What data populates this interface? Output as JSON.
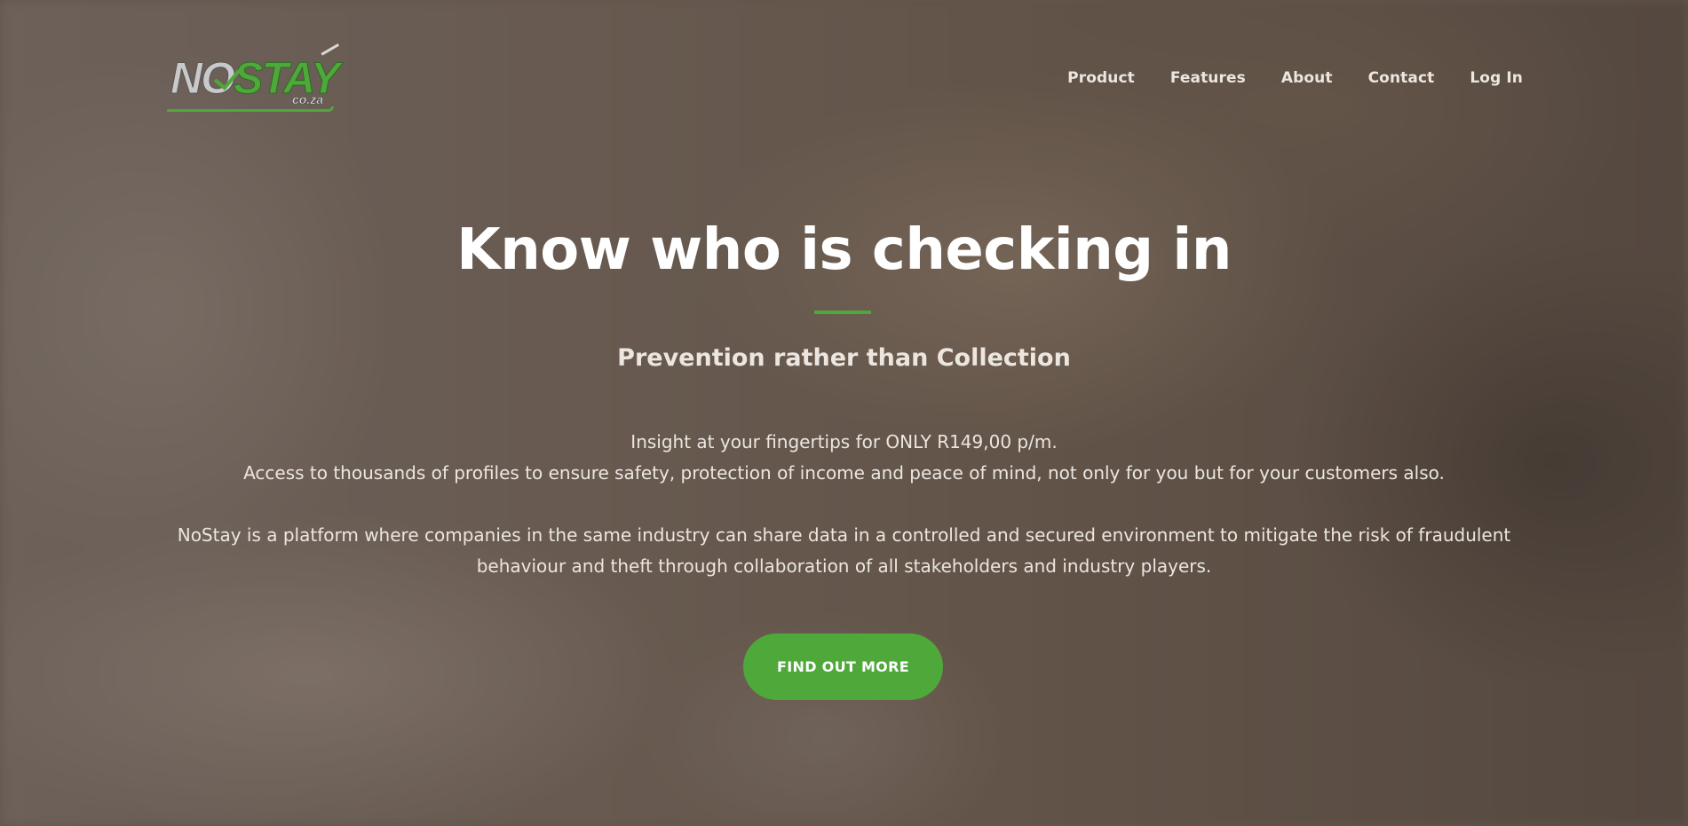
{
  "brand": {
    "logo_main_no": "NO",
    "logo_main_stay": "STAY",
    "logo_sub": "co.za",
    "accent_color": "#4ea83a"
  },
  "nav": {
    "items": [
      {
        "label": "Product"
      },
      {
        "label": "Features"
      },
      {
        "label": "About"
      },
      {
        "label": "Contact"
      },
      {
        "label": "Log In"
      }
    ]
  },
  "hero": {
    "headline": "Know who is checking in",
    "subheadline": "Prevention rather than Collection",
    "paragraph1": {
      "line1": "Insight at your fingertips for ONLY R149,00 p/m.",
      "line2": "Access to thousands of profiles to ensure safety, protection of income and peace of mind, not only for you but for your customers also."
    },
    "paragraph2": {
      "line1": "NoStay is a platform where companies in the same industry can share data in a controlled and secured environment to mitigate the risk of fraudulent",
      "line2": "behaviour and theft through collaboration of all stakeholders and industry players."
    },
    "cta_label": "FIND OUT MORE"
  }
}
